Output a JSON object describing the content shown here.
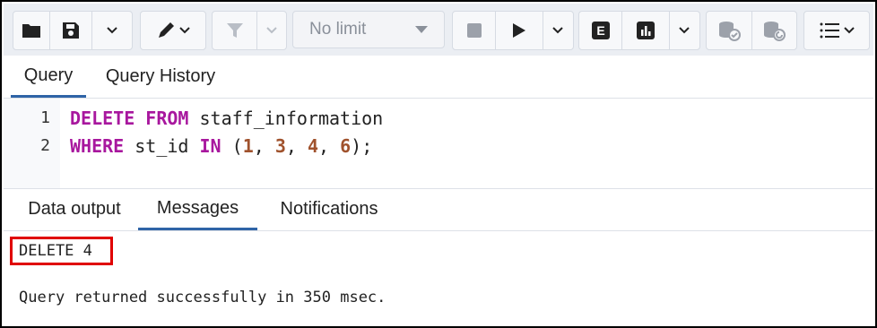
{
  "toolbar": {
    "buttons": [
      {
        "icon": "folder-open-icon"
      },
      {
        "icon": "save-icon"
      },
      {
        "icon": "edit-icon"
      },
      {
        "icon": "filter-icon"
      },
      {
        "icon": "stop-icon"
      },
      {
        "icon": "execute-icon"
      },
      {
        "icon": "explain-icon"
      },
      {
        "icon": "explain-analyze-icon"
      },
      {
        "icon": "commit-icon"
      },
      {
        "icon": "rollback-icon"
      },
      {
        "icon": "macros-icon"
      }
    ],
    "limit_label": "No limit",
    "explain_letter": "E"
  },
  "query_tabs": [
    {
      "label": "Query",
      "active": true
    },
    {
      "label": "Query History",
      "active": false
    }
  ],
  "editor": {
    "lines": [
      {
        "number": "1",
        "tokens": [
          {
            "t": "DELETE FROM",
            "c": "kw"
          },
          {
            "t": " staff_information",
            "c": ""
          }
        ]
      },
      {
        "number": "2",
        "tokens": [
          {
            "t": "WHERE",
            "c": "kw"
          },
          {
            "t": " st_id ",
            "c": ""
          },
          {
            "t": "IN",
            "c": "kw"
          },
          {
            "t": " (",
            "c": ""
          },
          {
            "t": "1",
            "c": "num"
          },
          {
            "t": ", ",
            "c": ""
          },
          {
            "t": "3",
            "c": "num"
          },
          {
            "t": ", ",
            "c": ""
          },
          {
            "t": "4",
            "c": "num"
          },
          {
            "t": ", ",
            "c": ""
          },
          {
            "t": "6",
            "c": "num"
          },
          {
            "t": ");",
            "c": ""
          }
        ]
      }
    ]
  },
  "output_tabs": [
    {
      "label": "Data output",
      "active": false
    },
    {
      "label": "Messages",
      "active": true
    },
    {
      "label": "Notifications",
      "active": false
    }
  ],
  "messages": {
    "result": "DELETE 4",
    "status": "Query returned successfully in 350 msec."
  },
  "colors": {
    "keyword": "#a8179e",
    "number": "#a0522d",
    "active_tab": "#2f64a7",
    "highlight_box": "#e00000"
  }
}
